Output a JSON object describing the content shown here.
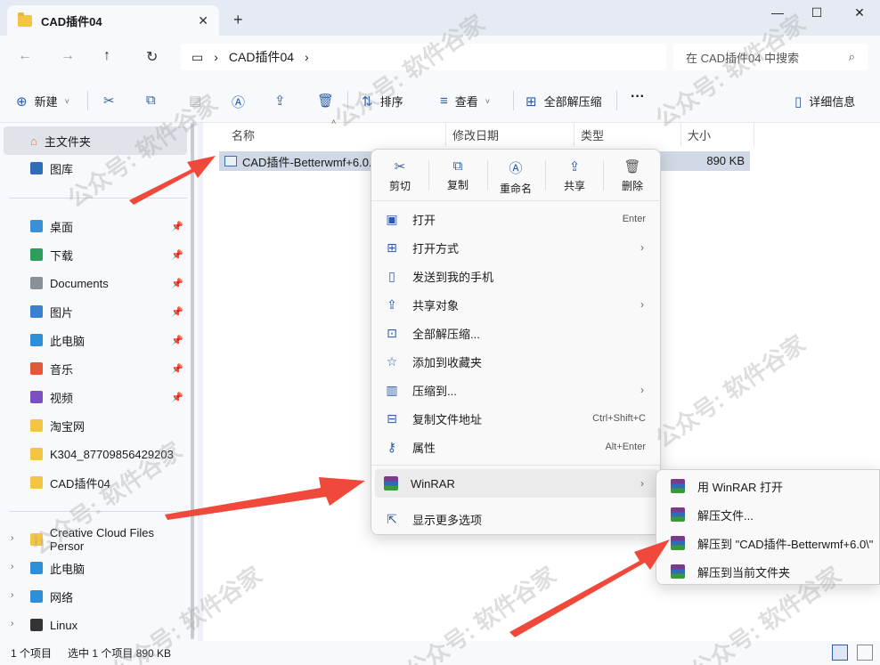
{
  "tab": {
    "title": "CAD插件04",
    "close": "✕",
    "new": "+"
  },
  "window": {
    "minimize": "—",
    "maximize": "☐",
    "close": "✕"
  },
  "address": {
    "path": "CAD插件04",
    "search_placeholder": "在 CAD插件04 中搜索"
  },
  "toolbar": {
    "new": "新建",
    "sort": "排序",
    "view": "查看",
    "extract_all": "全部解压缩",
    "more": "···",
    "details": "详细信息"
  },
  "sidebar": {
    "home": "主文件夹",
    "gallery": "图库",
    "quick": [
      {
        "label": "桌面",
        "color": "#3a8fd6"
      },
      {
        "label": "下载",
        "color": "#2e9c5a"
      },
      {
        "label": "Documents",
        "color": "#8a8f98"
      },
      {
        "label": "图片",
        "color": "#3a7fd0"
      },
      {
        "label": "此电脑",
        "color": "#2f8ed8"
      },
      {
        "label": "音乐",
        "color": "#e05a3a"
      },
      {
        "label": "视频",
        "color": "#7a4fc0"
      },
      {
        "label": "淘宝网",
        "color": "#f4c542"
      },
      {
        "label": "K304_87709856429203",
        "color": "#f4c542"
      },
      {
        "label": "CAD插件04",
        "color": "#f4c542"
      }
    ],
    "tree": [
      {
        "label": "Creative Cloud Files Persor",
        "color": "#f4c542"
      },
      {
        "label": "此电脑",
        "color": "#2f8ed8"
      },
      {
        "label": "网络",
        "color": "#2f8ed8"
      },
      {
        "label": "Linux",
        "color": "#333333"
      }
    ]
  },
  "columns": {
    "name": "名称",
    "modified": "修改日期",
    "type": "类型",
    "size": "大小"
  },
  "file": {
    "name": "CAD插件-Betterwmf+6.0.zip",
    "size": "890 KB"
  },
  "status": {
    "count": "1 个项目",
    "selected": "选中 1 个项目 890 KB"
  },
  "context_menu": {
    "quick_actions": [
      "剪切",
      "复制",
      "重命名",
      "共享",
      "删除"
    ],
    "items": [
      {
        "label": "打开",
        "shortcut": "Enter",
        "icon": "open-icon"
      },
      {
        "label": "打开方式",
        "arrow": "›",
        "icon": "open-with-icon"
      },
      {
        "label": "发送到我的手机",
        "icon": "phone-icon"
      },
      {
        "label": "共享对象",
        "arrow": "›",
        "icon": "share-icon"
      },
      {
        "label": "全部解压缩...",
        "icon": "extract-icon"
      },
      {
        "label": "添加到收藏夹",
        "icon": "star-icon"
      },
      {
        "label": "压缩到...",
        "arrow": "›",
        "icon": "compress-icon"
      },
      {
        "label": "复制文件地址",
        "shortcut": "Ctrl+Shift+C",
        "icon": "copy-path-icon"
      },
      {
        "label": "属性",
        "shortcut": "Alt+Enter",
        "icon": "properties-icon"
      }
    ],
    "winrar": "WinRAR",
    "more": "显示更多选项"
  },
  "submenu": [
    "用 WinRAR 打开",
    "解压文件...",
    "解压到 \"CAD插件-Betterwmf+6.0\\\"",
    "解压到当前文件夹"
  ],
  "watermark": "公众号: 软件谷家"
}
